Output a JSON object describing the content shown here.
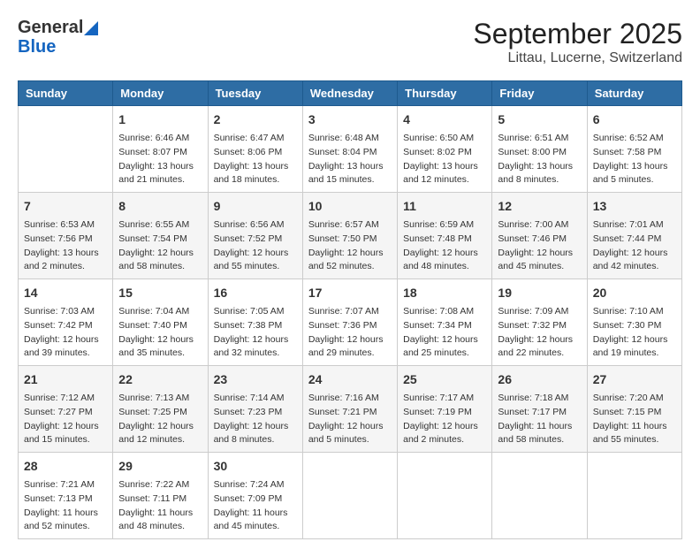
{
  "header": {
    "logo_general": "General",
    "logo_blue": "Blue",
    "title": "September 2025",
    "subtitle": "Littau, Lucerne, Switzerland"
  },
  "days": [
    "Sunday",
    "Monday",
    "Tuesday",
    "Wednesday",
    "Thursday",
    "Friday",
    "Saturday"
  ],
  "weeks": [
    [
      {
        "date": "",
        "info": ""
      },
      {
        "date": "1",
        "info": "Sunrise: 6:46 AM\nSunset: 8:07 PM\nDaylight: 13 hours\nand 21 minutes."
      },
      {
        "date": "2",
        "info": "Sunrise: 6:47 AM\nSunset: 8:06 PM\nDaylight: 13 hours\nand 18 minutes."
      },
      {
        "date": "3",
        "info": "Sunrise: 6:48 AM\nSunset: 8:04 PM\nDaylight: 13 hours\nand 15 minutes."
      },
      {
        "date": "4",
        "info": "Sunrise: 6:50 AM\nSunset: 8:02 PM\nDaylight: 13 hours\nand 12 minutes."
      },
      {
        "date": "5",
        "info": "Sunrise: 6:51 AM\nSunset: 8:00 PM\nDaylight: 13 hours\nand 8 minutes."
      },
      {
        "date": "6",
        "info": "Sunrise: 6:52 AM\nSunset: 7:58 PM\nDaylight: 13 hours\nand 5 minutes."
      }
    ],
    [
      {
        "date": "7",
        "info": "Sunrise: 6:53 AM\nSunset: 7:56 PM\nDaylight: 13 hours\nand 2 minutes."
      },
      {
        "date": "8",
        "info": "Sunrise: 6:55 AM\nSunset: 7:54 PM\nDaylight: 12 hours\nand 58 minutes."
      },
      {
        "date": "9",
        "info": "Sunrise: 6:56 AM\nSunset: 7:52 PM\nDaylight: 12 hours\nand 55 minutes."
      },
      {
        "date": "10",
        "info": "Sunrise: 6:57 AM\nSunset: 7:50 PM\nDaylight: 12 hours\nand 52 minutes."
      },
      {
        "date": "11",
        "info": "Sunrise: 6:59 AM\nSunset: 7:48 PM\nDaylight: 12 hours\nand 48 minutes."
      },
      {
        "date": "12",
        "info": "Sunrise: 7:00 AM\nSunset: 7:46 PM\nDaylight: 12 hours\nand 45 minutes."
      },
      {
        "date": "13",
        "info": "Sunrise: 7:01 AM\nSunset: 7:44 PM\nDaylight: 12 hours\nand 42 minutes."
      }
    ],
    [
      {
        "date": "14",
        "info": "Sunrise: 7:03 AM\nSunset: 7:42 PM\nDaylight: 12 hours\nand 39 minutes."
      },
      {
        "date": "15",
        "info": "Sunrise: 7:04 AM\nSunset: 7:40 PM\nDaylight: 12 hours\nand 35 minutes."
      },
      {
        "date": "16",
        "info": "Sunrise: 7:05 AM\nSunset: 7:38 PM\nDaylight: 12 hours\nand 32 minutes."
      },
      {
        "date": "17",
        "info": "Sunrise: 7:07 AM\nSunset: 7:36 PM\nDaylight: 12 hours\nand 29 minutes."
      },
      {
        "date": "18",
        "info": "Sunrise: 7:08 AM\nSunset: 7:34 PM\nDaylight: 12 hours\nand 25 minutes."
      },
      {
        "date": "19",
        "info": "Sunrise: 7:09 AM\nSunset: 7:32 PM\nDaylight: 12 hours\nand 22 minutes."
      },
      {
        "date": "20",
        "info": "Sunrise: 7:10 AM\nSunset: 7:30 PM\nDaylight: 12 hours\nand 19 minutes."
      }
    ],
    [
      {
        "date": "21",
        "info": "Sunrise: 7:12 AM\nSunset: 7:27 PM\nDaylight: 12 hours\nand 15 minutes."
      },
      {
        "date": "22",
        "info": "Sunrise: 7:13 AM\nSunset: 7:25 PM\nDaylight: 12 hours\nand 12 minutes."
      },
      {
        "date": "23",
        "info": "Sunrise: 7:14 AM\nSunset: 7:23 PM\nDaylight: 12 hours\nand 8 minutes."
      },
      {
        "date": "24",
        "info": "Sunrise: 7:16 AM\nSunset: 7:21 PM\nDaylight: 12 hours\nand 5 minutes."
      },
      {
        "date": "25",
        "info": "Sunrise: 7:17 AM\nSunset: 7:19 PM\nDaylight: 12 hours\nand 2 minutes."
      },
      {
        "date": "26",
        "info": "Sunrise: 7:18 AM\nSunset: 7:17 PM\nDaylight: 11 hours\nand 58 minutes."
      },
      {
        "date": "27",
        "info": "Sunrise: 7:20 AM\nSunset: 7:15 PM\nDaylight: 11 hours\nand 55 minutes."
      }
    ],
    [
      {
        "date": "28",
        "info": "Sunrise: 7:21 AM\nSunset: 7:13 PM\nDaylight: 11 hours\nand 52 minutes."
      },
      {
        "date": "29",
        "info": "Sunrise: 7:22 AM\nSunset: 7:11 PM\nDaylight: 11 hours\nand 48 minutes."
      },
      {
        "date": "30",
        "info": "Sunrise: 7:24 AM\nSunset: 7:09 PM\nDaylight: 11 hours\nand 45 minutes."
      },
      {
        "date": "",
        "info": ""
      },
      {
        "date": "",
        "info": ""
      },
      {
        "date": "",
        "info": ""
      },
      {
        "date": "",
        "info": ""
      }
    ]
  ]
}
